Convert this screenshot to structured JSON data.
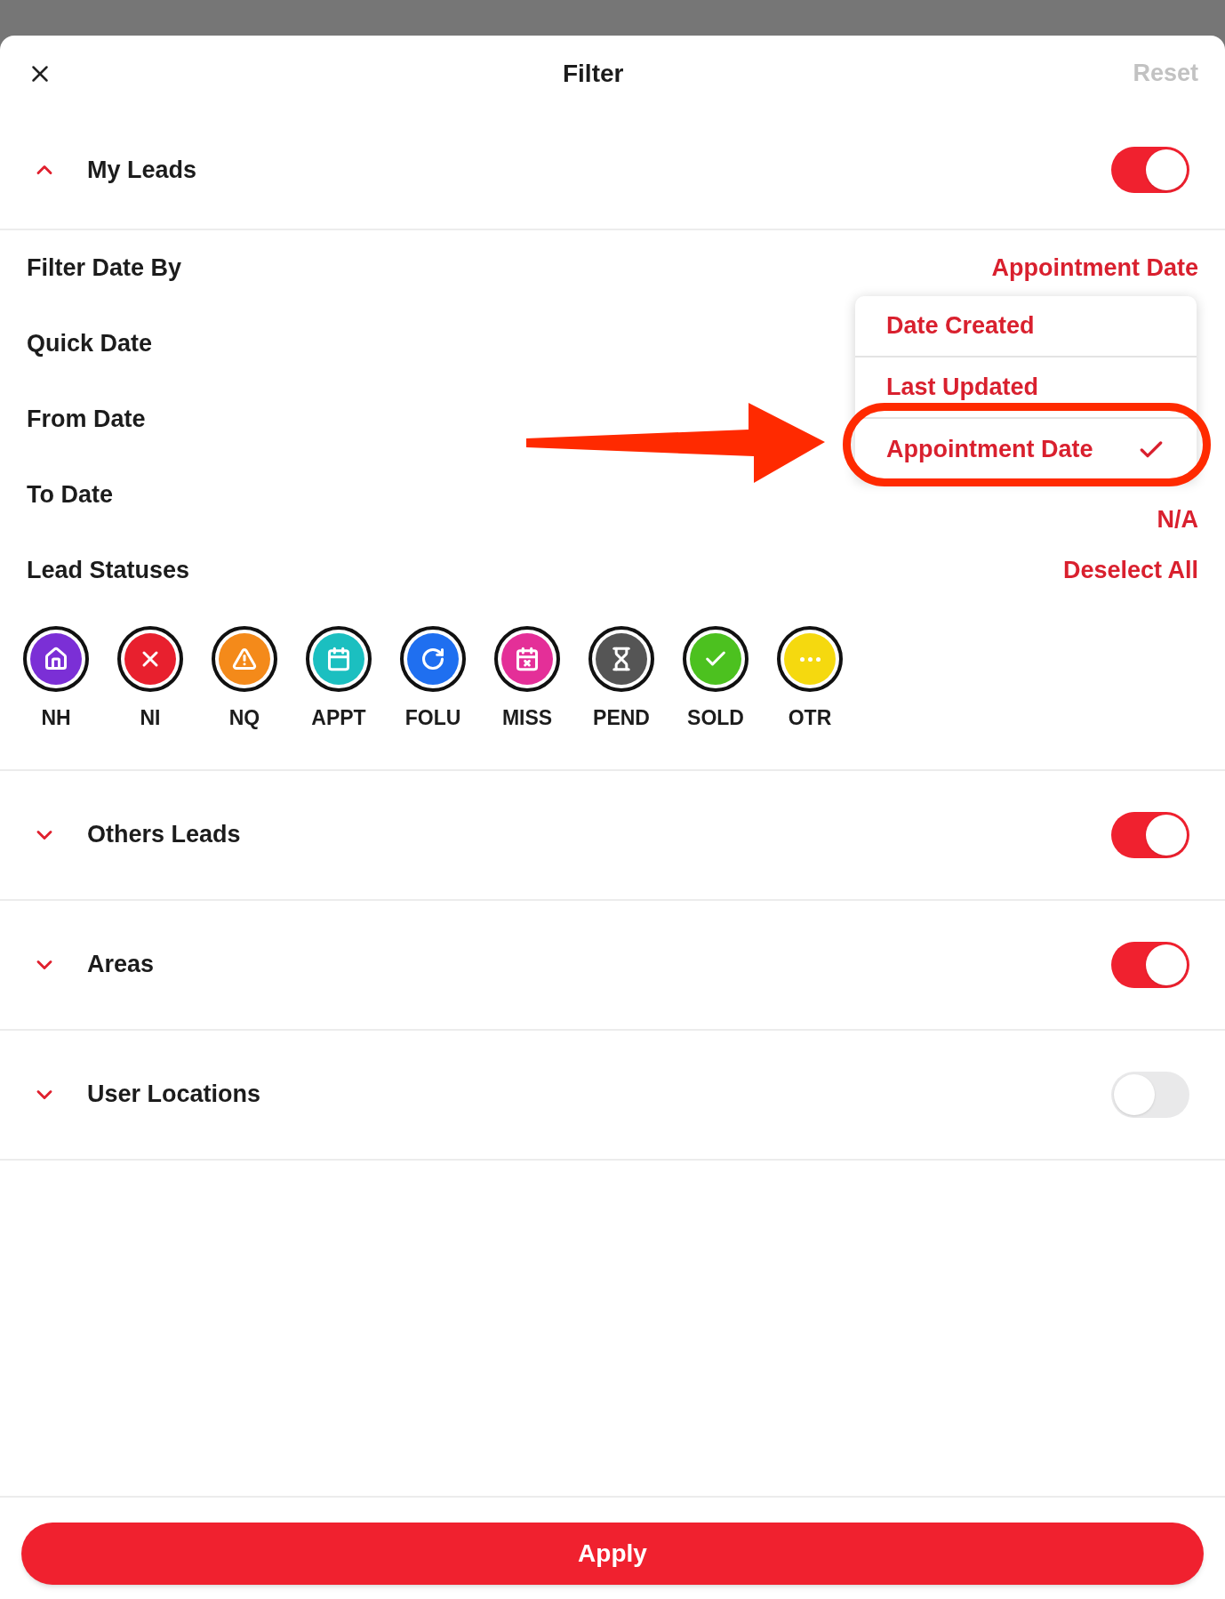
{
  "header": {
    "title": "Filter",
    "reset": "Reset"
  },
  "sections": [
    {
      "title": "My Leads",
      "expanded": true,
      "on": true
    },
    {
      "title": "Others Leads",
      "expanded": false,
      "on": true
    },
    {
      "title": "Areas",
      "expanded": false,
      "on": true
    },
    {
      "title": "User Locations",
      "expanded": false,
      "on": false
    }
  ],
  "my_leads": {
    "fields": [
      {
        "label": "Filter Date By",
        "value": "Appointment Date"
      },
      {
        "label": "Quick Date"
      },
      {
        "label": "From Date"
      },
      {
        "label": "To Date",
        "value": "N/A"
      }
    ],
    "statuses_label": "Lead Statuses",
    "deselect_all": "Deselect All",
    "statuses": [
      {
        "label": "NH",
        "kind": "home",
        "color": "#7b2fd6",
        "selected": true
      },
      {
        "label": "NI",
        "kind": "cross",
        "color": "#e8202e",
        "selected": true
      },
      {
        "label": "NQ",
        "kind": "warning",
        "color": "#f48a1a",
        "selected": true
      },
      {
        "label": "APPT",
        "kind": "calendar",
        "color": "#1bbfc0",
        "selected": true
      },
      {
        "label": "FOLU",
        "kind": "refresh",
        "color": "#1f6ff0",
        "selected": true
      },
      {
        "label": "MISS",
        "kind": "calendar-x",
        "color": "#e42f98",
        "selected": true
      },
      {
        "label": "PEND",
        "kind": "hourglass",
        "color": "#555555",
        "selected": true
      },
      {
        "label": "SOLD",
        "kind": "check",
        "color": "#4cc11f",
        "selected": true
      },
      {
        "label": "OTR",
        "kind": "more",
        "color": "#f5d90f",
        "selected": true
      }
    ]
  },
  "dropdown": {
    "options": [
      {
        "label": "Date Created",
        "selected": false
      },
      {
        "label": "Last Updated",
        "selected": false
      },
      {
        "label": "Appointment Date",
        "selected": true
      }
    ]
  },
  "apply": "Apply"
}
